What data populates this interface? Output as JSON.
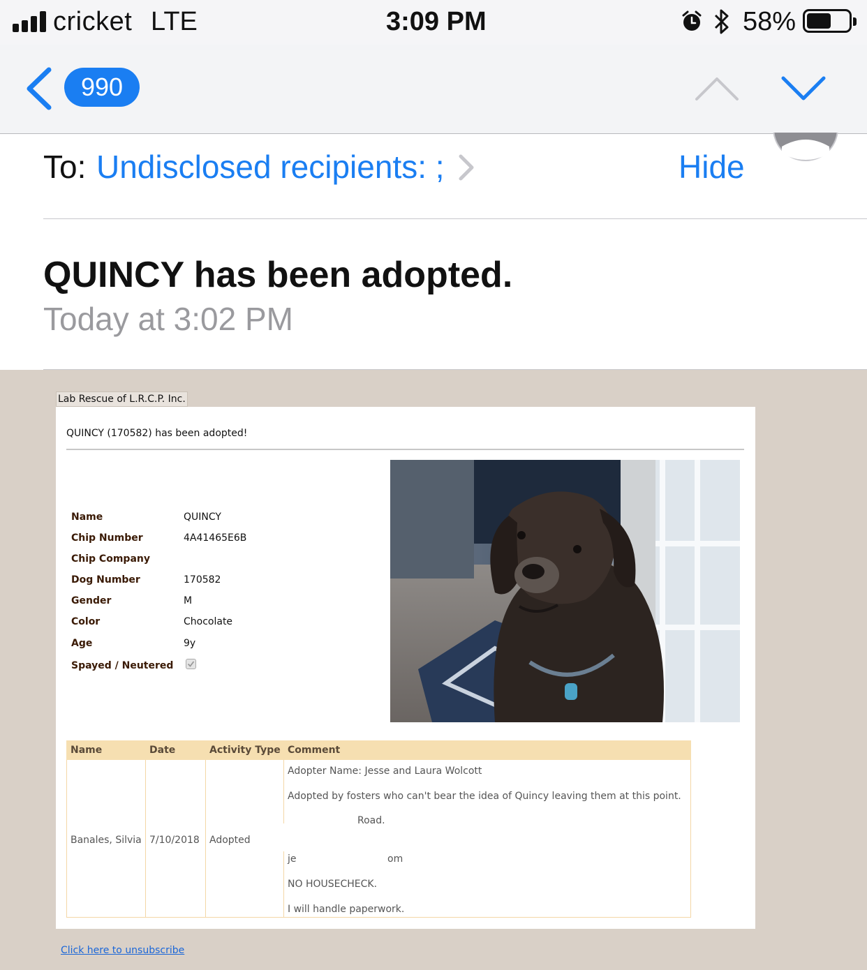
{
  "status_bar": {
    "carrier": "cricket",
    "network": "LTE",
    "time": "3:09 PM",
    "battery_percent": "58%",
    "battery_level": 0.58
  },
  "nav": {
    "back_badge": "990"
  },
  "header": {
    "to_label": "To:",
    "to_value": "Undisclosed recipients: ;",
    "hide_label": "Hide",
    "subject": "QUINCY has been adopted.",
    "datetime": "Today at 3:02 PM"
  },
  "email": {
    "org_name": "Lab Rescue of L.R.C.P. Inc.",
    "notice": "QUINCY (170582) has been adopted!",
    "fields": [
      {
        "label": "Name",
        "value": "QUINCY"
      },
      {
        "label": "Chip Number",
        "value": "4A41465E6B"
      },
      {
        "label": "Chip Company",
        "value": ""
      },
      {
        "label": "Dog Number",
        "value": "170582"
      },
      {
        "label": "Gender",
        "value": "M"
      },
      {
        "label": "Color",
        "value": "Chocolate"
      },
      {
        "label": "Age",
        "value": "9y"
      },
      {
        "label": "Spayed / Neutered",
        "value": "",
        "checked": true
      }
    ],
    "table": {
      "headers": [
        "Name",
        "Date",
        "Activity Type",
        "Comment"
      ],
      "row": {
        "name": "Banales, Silvia",
        "date": "7/10/2018",
        "activity": "Adopted",
        "comments": [
          "Adopter Name: Jesse and Laura Wolcott",
          "Adopted by fosters who can't bear the idea of Quincy leaving them at this point.",
          "Road.",
          "je",
          "om",
          "NO HOUSECHECK.",
          "I will handle paperwork."
        ]
      }
    },
    "unsubscribe": "Click here to unsubscribe"
  },
  "colors": {
    "ios_blue": "#1a7ef2",
    "body_bg": "#d9d0c7",
    "table_header_bg": "#f6dfb1",
    "label_brown": "#3a1a05"
  }
}
